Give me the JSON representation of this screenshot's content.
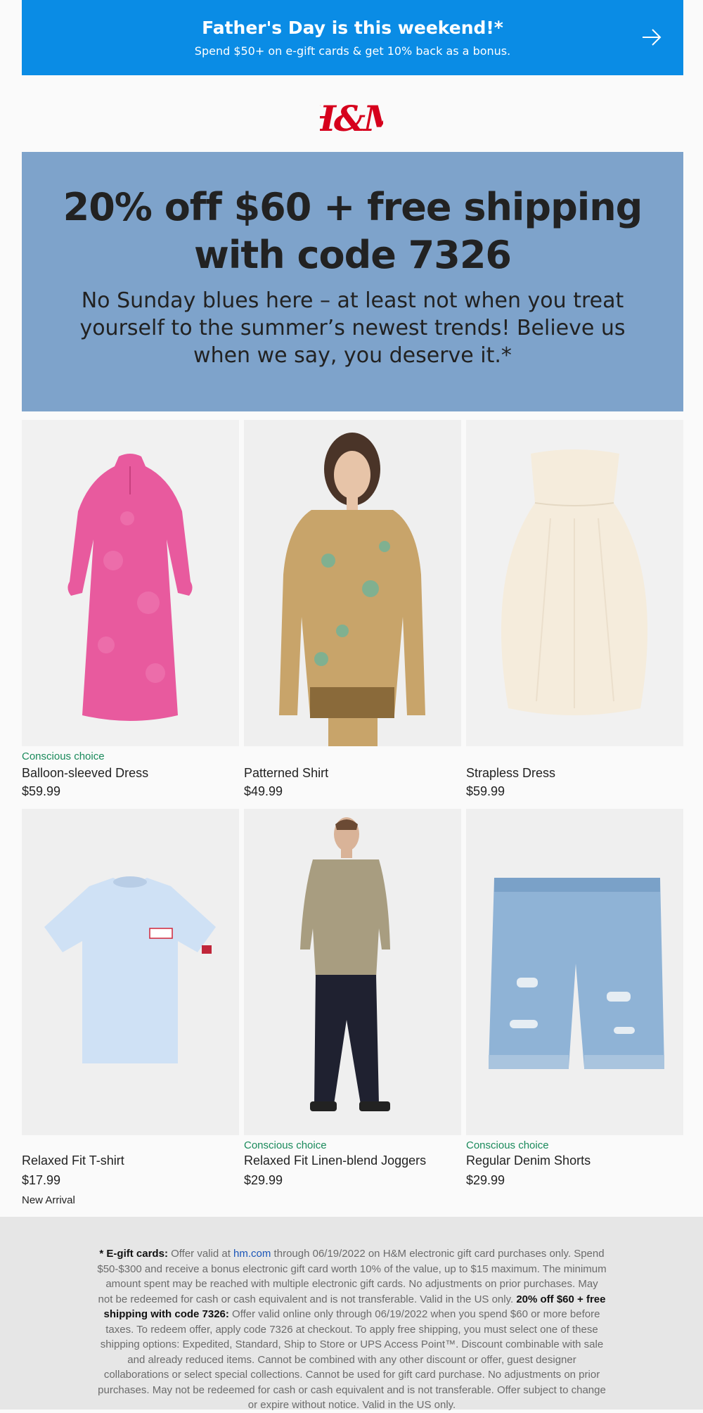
{
  "banner": {
    "title": "Father's Day is this weekend!*",
    "subtitle": "Spend $50+ on e-gift cards & get 10% back as a bonus.",
    "bg_color": "#0a8ce5",
    "icon": "arrow-right-icon"
  },
  "brand": {
    "logo_text": "H&M",
    "logo_color": "#d6001c"
  },
  "hero": {
    "title_line1": "20% off $60 + free shipping",
    "title_line2": "with code 7326",
    "body": "No Sunday blues here – at least not when you treat yourself to the summer’s newest trends! Believe us when we say, you deserve it.*",
    "bg_color": "#7ea3cb"
  },
  "products": [
    {
      "tag": "Conscious choice",
      "name": "Balloon-sleeved Dress",
      "price": "$59.99",
      "badge": ""
    },
    {
      "tag": "",
      "name": "Patterned Shirt",
      "price": "$49.99",
      "badge": ""
    },
    {
      "tag": "",
      "name": "Strapless Dress",
      "price": "$59.99",
      "badge": ""
    },
    {
      "tag": "",
      "name": "Relaxed Fit T-shirt",
      "price": "$17.99",
      "badge": "New Arrival"
    },
    {
      "tag": "Conscious choice",
      "name": "Relaxed Fit Linen-blend Joggers",
      "price": "$29.99",
      "badge": ""
    },
    {
      "tag": "Conscious choice",
      "name": "Regular Denim Shorts",
      "price": "$29.99",
      "badge": ""
    }
  ],
  "footer": {
    "egift_label": "* E-gift cards:",
    "egift_text1": " Offer valid at ",
    "egift_link": "hm.com",
    "egift_text2": " through 06/19/2022 on H&M electronic gift card purchases only. Spend $50-$300 and receive a bonus electronic gift card worth 10% of the value, up to $15 maximum. The minimum amount spent may be reached with multiple electronic gift cards. No adjustments on prior purchases. May not be redeemed for cash or cash equivalent and is not transferable. Valid in the US only. ",
    "promo_label": " 20% off $60 + free shipping with code 7326:",
    "promo_text": " Offer valid online only through 06/19/2022 when you spend $60 or more before taxes. To redeem offer, apply code 7326 at checkout. To apply free shipping, you must select one of these shipping options: Expedited, Standard, Ship to Store or UPS Access Point™. Discount combinable with sale and already reduced items. Cannot be combined with any other discount or offer, guest designer collaborations or select special collections. Cannot be used for gift card purchase. No adjustments on prior purchases. May not be redeemed for cash or cash equivalent and is not transferable. Offer subject to change or expire without notice. Valid in the US only."
  }
}
